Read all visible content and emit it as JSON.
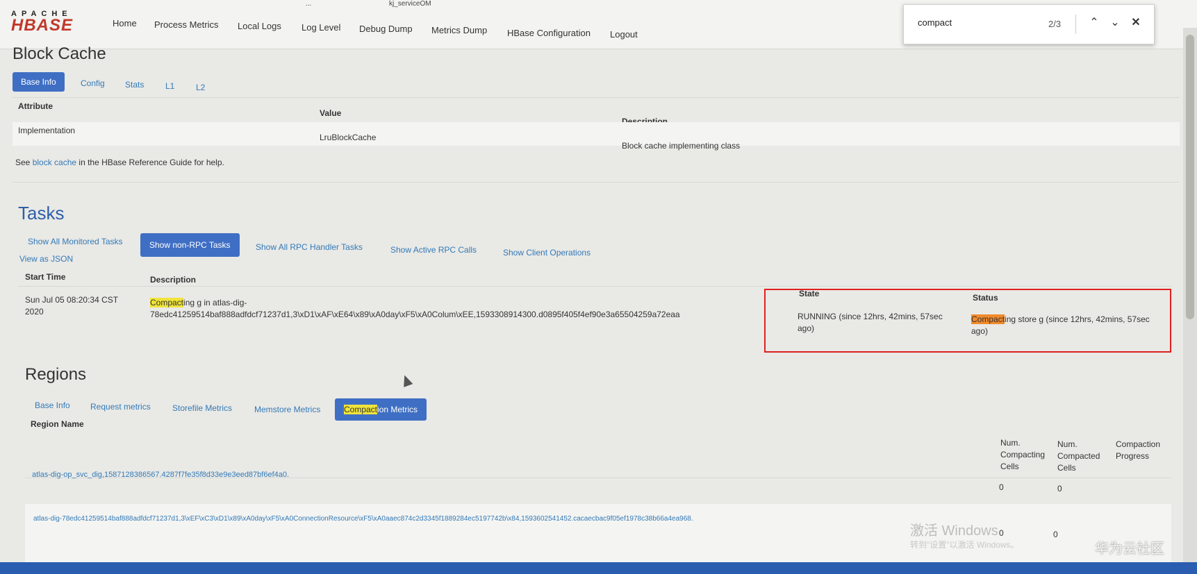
{
  "browser": {
    "tab_titles": [
      "",
      "...",
      "kj_serviceOM"
    ]
  },
  "logo": {
    "small": "APACHE",
    "big": "HBASE"
  },
  "nav": [
    "Home",
    "Process Metrics",
    "Local Logs",
    "Log Level",
    "Debug Dump",
    "Metrics Dump",
    "HBase Configuration",
    "Logout"
  ],
  "find": {
    "query": "compact",
    "count": "2/3",
    "prev_icon": "chevron-up",
    "next_icon": "chevron-down",
    "close_icon": "close"
  },
  "block_cache": {
    "title": "Block Cache",
    "tabs": [
      "Base Info",
      "Config",
      "Stats",
      "L1",
      "L2"
    ],
    "active_tab": "Base Info",
    "headers": [
      "Attribute",
      "Value",
      "Description"
    ],
    "rows": [
      [
        "Implementation",
        "LruBlockCache",
        "Block cache implementing class"
      ]
    ],
    "help_pre": "See ",
    "help_link": "block cache",
    "help_post": " in the HBase Reference Guide for help."
  },
  "tasks": {
    "title": "Tasks",
    "filters": [
      "Show All Monitored Tasks",
      "Show non-RPC Tasks",
      "Show All RPC Handler Tasks",
      "Show Active RPC Calls",
      "Show Client Operations"
    ],
    "active_filter": "Show non-RPC Tasks",
    "json_link": "View as JSON",
    "headers": [
      "Start Time",
      "Description",
      "State",
      "Status"
    ],
    "row": {
      "start_time": "Sun Jul 05 08:20:34 CST 2020",
      "desc_hl": "Compact",
      "desc_rest_line1": "ing g in atlas-dig-",
      "desc_line2": "78edc41259514baf888adfdcf71237d1,3\\xD1\\xAF\\xE64\\x89\\xA0day\\xF5\\xA0Colum\\xEE,1593308914300.d0895f405f4ef90e3a65504259a72eaa",
      "state": "RUNNING (since 12hrs, 42mins, 57sec ago)",
      "status_hl": "Compact",
      "status_rest": "ing store g (since 12hrs, 42mins, 57sec ago)"
    }
  },
  "regions": {
    "title": "Regions",
    "tabs": [
      "Base Info",
      "Request metrics",
      "Storefile Metrics",
      "Memstore Metrics"
    ],
    "active_tab_hl": "Compact",
    "active_tab_rest": "ion Metrics",
    "headers": [
      "Region Name",
      "Num. Compacting Cells",
      "Num. Compacted Cells",
      "Compaction Progress"
    ],
    "rows": [
      {
        "name": "atlas-dig-op_svc_dig,1587128386567.4287f7fe35f8d33e9e3eed87bf6ef4a0.",
        "compacting": "0",
        "compacted": "0",
        "progress": ""
      },
      {
        "name": "atlas-dig-78edc41259514baf888adfdcf71237d1,3\\xEF\\xC3\\xD1\\x89\\xA0day\\xF5\\xA0ConnectionResource\\xF5\\xA0aaec874c2d3345f1889284ec5197742b\\x84,1593602541452.cacaecbac9f05ef1978c38b66a4ea968.",
        "compacting": "0",
        "compacted": "0",
        "progress": ""
      }
    ]
  },
  "overlay": {
    "activate_windows": "激活 Windows",
    "activate_hint": "转到\"设置\"以激活 Windows。",
    "corner_watermark": "华为云社区"
  },
  "colors": {
    "highlight": "#f0e43a",
    "current_highlight": "#f28a2b",
    "accent": "#3f6fc4",
    "annotation_box": "#e02020"
  }
}
